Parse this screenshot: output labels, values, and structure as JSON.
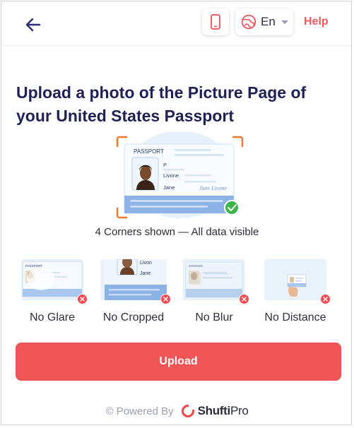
{
  "header": {
    "language": "En",
    "help_label": "Help",
    "icons": [
      "back-arrow-icon",
      "mobile-phone-icon",
      "globe-icon",
      "chevron-down-icon"
    ]
  },
  "title": "Upload a photo of the Picture Page of your United States Passport",
  "hero": {
    "caption": "4 Corners shown — All data visible",
    "passport": {
      "heading": "PASSPORT",
      "type": "P",
      "surname": "Livone",
      "given_name": "Jane",
      "signature": "Jane Livone"
    }
  },
  "tips": [
    {
      "label": "No Glare"
    },
    {
      "label": "No Cropped",
      "crop_surname": "Livon",
      "crop_given_name": "Jane"
    },
    {
      "label": "No Blur"
    },
    {
      "label": "No Distance"
    }
  ],
  "upload_label": "Upload",
  "footer": {
    "powered_by": "© Powered By",
    "brand_main": "Shufti",
    "brand_sub": "Pro"
  },
  "colors": {
    "accent": "#ef5457",
    "title": "#1f2155",
    "success": "#3bb54a",
    "corner": "#f07a2f"
  }
}
